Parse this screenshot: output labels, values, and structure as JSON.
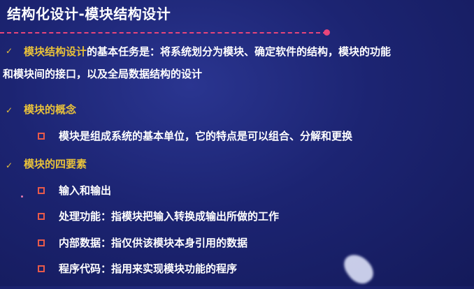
{
  "slide": {
    "title": "结构化设计-模块结构设计",
    "accent_color": "#e8c13a",
    "rule_color": "#e8457a",
    "bullet_color": "#e85a4a"
  },
  "point1": {
    "highlight": "模块结构设计",
    "rest_line1": "的基本任务是：将系统划分为模块、确定软件的结构，模块的功能",
    "line2": "和模块间的接口，以及全局数据结构的设计"
  },
  "point2": {
    "heading": "模块的概念",
    "items": [
      "模块是组成系统的基本单位，它的特点是可以组合、分解和更换"
    ]
  },
  "point3": {
    "heading": "模块的四要素",
    "items": [
      "输入和输出",
      "处理功能：指模块把输入转换成输出所做的工作",
      "内部数据：指仅供该模块本身引用的数据",
      "程序代码：指用来实现模块功能的程序"
    ]
  },
  "icons": {
    "check": "✓",
    "check_name": "check-mark-icon",
    "bullet_name": "square-bullet-icon"
  }
}
